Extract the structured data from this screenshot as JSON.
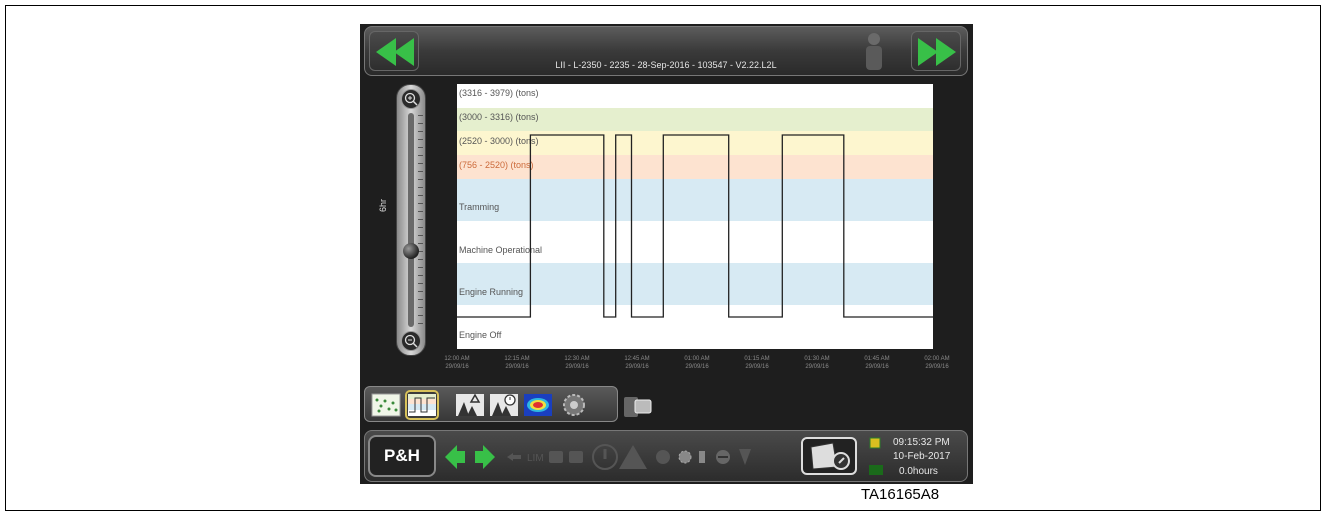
{
  "header": {
    "title": "LII - L-2350 - 2235 - 28-Sep-2016 - 103547 - V2.22.L2L"
  },
  "zoom_slider": {
    "label": "6hr",
    "level_fraction": 0.63
  },
  "chart_data": {
    "type": "step-line",
    "bands": [
      {
        "label": "(3316  - 3979) (tons)",
        "color": "#ffffff",
        "text_color": "#555555"
      },
      {
        "label": "(3000  - 3316) (tons)",
        "color": "#e5efce",
        "text_color": "#555555"
      },
      {
        "label": "(2520  - 3000) (tons)",
        "color": "#fdf6cf",
        "text_color": "#555555"
      },
      {
        "label": "(756  - 2520) (tons)",
        "color": "#fde3d0",
        "text_color": "#cc6a3a"
      },
      {
        "label": "Tramming",
        "color": "#d7eaf3",
        "text_color": "#555555"
      },
      {
        "label": "Machine Operational",
        "color": "#ffffff",
        "text_color": "#555555"
      },
      {
        "label": "Engine Running",
        "color": "#d7eaf3",
        "text_color": "#555555"
      },
      {
        "label": "Engine Off",
        "color": "#ffffff",
        "text_color": "#555555"
      }
    ],
    "x_ticks": [
      {
        "time": "12:00 AM",
        "date": "29/09/16"
      },
      {
        "time": "12:15 AM",
        "date": "29/09/16"
      },
      {
        "time": "12:30 AM",
        "date": "29/09/16"
      },
      {
        "time": "12:45 AM",
        "date": "29/09/16"
      },
      {
        "time": "01:00 AM",
        "date": "29/09/16"
      },
      {
        "time": "01:15 AM",
        "date": "29/09/16"
      },
      {
        "time": "01:30 AM",
        "date": "29/09/16"
      },
      {
        "time": "01:45 AM",
        "date": "29/09/16"
      },
      {
        "time": "02:00 AM",
        "date": "29/09/16"
      }
    ],
    "x_range_minutes": [
      0,
      120
    ],
    "series": [
      {
        "points": [
          [
            0,
            "Machine Operational"
          ],
          [
            18.5,
            "Machine Operational"
          ],
          [
            18.5,
            "(3000  - 3316) (tons)"
          ],
          [
            37,
            "(3000  - 3316) (tons)"
          ],
          [
            37,
            "Machine Operational"
          ],
          [
            40,
            "Machine Operational"
          ],
          [
            40,
            "(3000  - 3316) (tons)"
          ],
          [
            44,
            "(3000  - 3316) (tons)"
          ],
          [
            44,
            "Machine Operational"
          ],
          [
            52,
            "Machine Operational"
          ],
          [
            52,
            "(3000  - 3316) (tons)"
          ],
          [
            68.5,
            "(3000  - 3316) (tons)"
          ],
          [
            68.5,
            "Machine Operational"
          ],
          [
            82,
            "Machine Operational"
          ],
          [
            82,
            "(3000  - 3316) (tons)"
          ],
          [
            97.5,
            "(3000  - 3316) (tons)"
          ],
          [
            97.5,
            "Machine Operational"
          ],
          [
            120,
            "Machine Operational"
          ]
        ]
      }
    ]
  },
  "status": {
    "time": "09:15:32 PM",
    "date": "10-Feb-2017",
    "hours": "0.0hours",
    "logo_text": "P&H",
    "lim_text": "LIM"
  },
  "tabs": [
    "scatter-view-icon",
    "band-chart-icon",
    "machine-lift-icon",
    "machine-timer-icon",
    "heatmap-icon",
    "gear-view-icon"
  ],
  "caption": "TA16165A8"
}
